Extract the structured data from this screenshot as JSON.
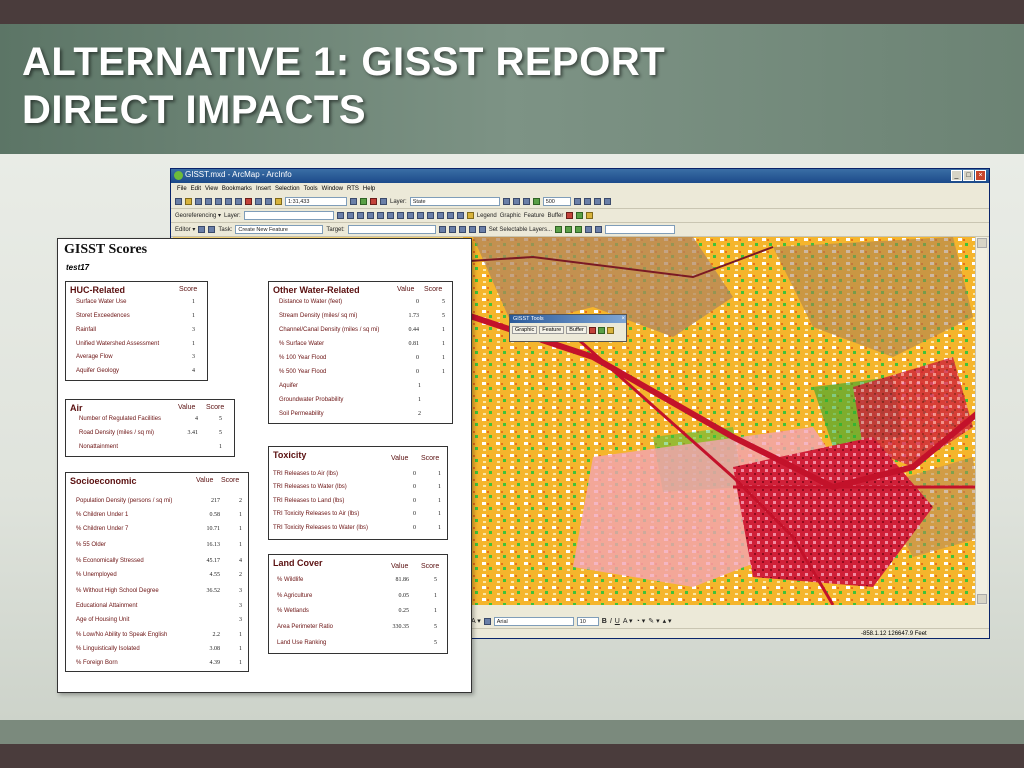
{
  "slide": {
    "title_line1": "ALTERNATIVE 1: GISST REPORT",
    "title_line2": "DIRECT IMPACTS"
  },
  "arcmap": {
    "window_title": "GISST.mxd - ArcMap - ArcInfo",
    "menu": [
      "File",
      "Edit",
      "View",
      "Bookmarks",
      "Insert",
      "Selection",
      "Tools",
      "Window",
      "RTS",
      "Help"
    ],
    "scale": "1:31,433",
    "layer_label": "Layer:",
    "layer_value": "State",
    "georeferencing_label": "Georeferencing ▾",
    "layer2_label": "Layer:",
    "editor_label": "Editor ▾",
    "task_label": "Task:",
    "task_value": "Create New Feature",
    "target_label": "Target:",
    "set_selectable": "Set Selectable Layers...",
    "toolbar_right": [
      "Legend",
      "Graphic",
      "Feature",
      "Buffer"
    ],
    "zoom_value": "500",
    "font_name": "Arial",
    "font_size": "10",
    "coords": "-858.1.12  126647.9 Feet"
  },
  "gisst_tools": {
    "title": "GISST Tools",
    "buttons": [
      "Graphic",
      "Feature",
      "Buffer"
    ]
  },
  "report": {
    "title": "GISST Scores",
    "subtitle": "test17",
    "value_head": "Value",
    "score_head": "Score",
    "huc": {
      "title": "HUC-Related",
      "rows": [
        {
          "label": "Surface Water Use",
          "score": "1"
        },
        {
          "label": "Storet Exceedences",
          "score": "1"
        },
        {
          "label": "Rainfall",
          "score": "3"
        },
        {
          "label": "Unified Watershed Assessment",
          "score": "1"
        },
        {
          "label": "Average Flow",
          "score": "3"
        },
        {
          "label": "Aquifer Geology",
          "score": "4"
        }
      ]
    },
    "air": {
      "title": "Air",
      "rows": [
        {
          "label": "Number of Regulated Facilities",
          "value": "4",
          "score": "5"
        },
        {
          "label": "Road Density (miles / sq mi)",
          "value": "3.41",
          "score": "5"
        },
        {
          "label": "Nonattainment",
          "value": "",
          "score": "1"
        }
      ]
    },
    "socio": {
      "title": "Socioeconomic",
      "rows": [
        {
          "label": "Population Density (persons / sq mi)",
          "value": "217",
          "score": "2"
        },
        {
          "label": "% Children Under 1",
          "value": "0.58",
          "score": "1"
        },
        {
          "label": "% Children Under 7",
          "value": "10.71",
          "score": "1"
        },
        {
          "label": "% 55  Older",
          "value": "16.13",
          "score": "1"
        },
        {
          "label": "% Economically Stressed",
          "value": "45.17",
          "score": "4"
        },
        {
          "label": "% Unemployed",
          "value": "4.55",
          "score": "2"
        },
        {
          "label": "% Without High School Degree",
          "value": "36.52",
          "score": "3"
        },
        {
          "label": "Educational Attainment",
          "value": "",
          "score": "3"
        },
        {
          "label": "Age of Housing Unit",
          "value": "",
          "score": "3"
        },
        {
          "label": "% Low/No Ability to Speak English",
          "value": "2.2",
          "score": "1"
        },
        {
          "label": "% Linguistically Isolated",
          "value": "3.08",
          "score": "1"
        },
        {
          "label": "% Foreign Born",
          "value": "4.39",
          "score": "1"
        }
      ]
    },
    "other_water": {
      "title": "Other Water-Related",
      "rows": [
        {
          "label": "Distance to Water (feet)",
          "value": "0",
          "score": "5"
        },
        {
          "label": "Stream Density (miles/ sq mi)",
          "value": "1.73",
          "score": "5"
        },
        {
          "label": "Channel/Canal Density (miles / sq mi)",
          "value": "0.44",
          "score": "1"
        },
        {
          "label": "% Surface Water",
          "value": "0.81",
          "score": "1"
        },
        {
          "label": "% 100 Year Flood",
          "value": "0",
          "score": "1"
        },
        {
          "label": "% 500 Year Flood",
          "value": "0",
          "score": "1"
        },
        {
          "label": "Aquifer",
          "value": "",
          "score": "1"
        },
        {
          "label": "Groundwater Probability",
          "value": "",
          "score": "1"
        },
        {
          "label": "Soil Permeability",
          "value": "",
          "score": "2"
        }
      ]
    },
    "toxicity": {
      "title": "Toxicity",
      "rows": [
        {
          "label": "TRI Releases to Air (lbs)",
          "value": "0",
          "score": "1"
        },
        {
          "label": "TRI Releases to Water (lbs)",
          "value": "0",
          "score": "1"
        },
        {
          "label": "TRI Releases to Land (lbs)",
          "value": "0",
          "score": "1"
        },
        {
          "label": "TRI Toxicity Releases to Air (lbs)",
          "value": "0",
          "score": "1"
        },
        {
          "label": "TRI Toxicity Releases to Water (lbs)",
          "value": "0",
          "score": "1"
        }
      ]
    },
    "land": {
      "title": "Land Cover",
      "rows": [
        {
          "label": "% Wildlife",
          "value": "81.86",
          "score": "5"
        },
        {
          "label": "% Agriculture",
          "value": "0.05",
          "score": "1"
        },
        {
          "label": "% Wetlands",
          "value": "0.25",
          "score": "1"
        },
        {
          "label": "Area Perimeter Ratio",
          "value": "330.35",
          "score": "5"
        },
        {
          "label": "Land Use Ranking",
          "value": "",
          "score": "5"
        }
      ]
    }
  }
}
